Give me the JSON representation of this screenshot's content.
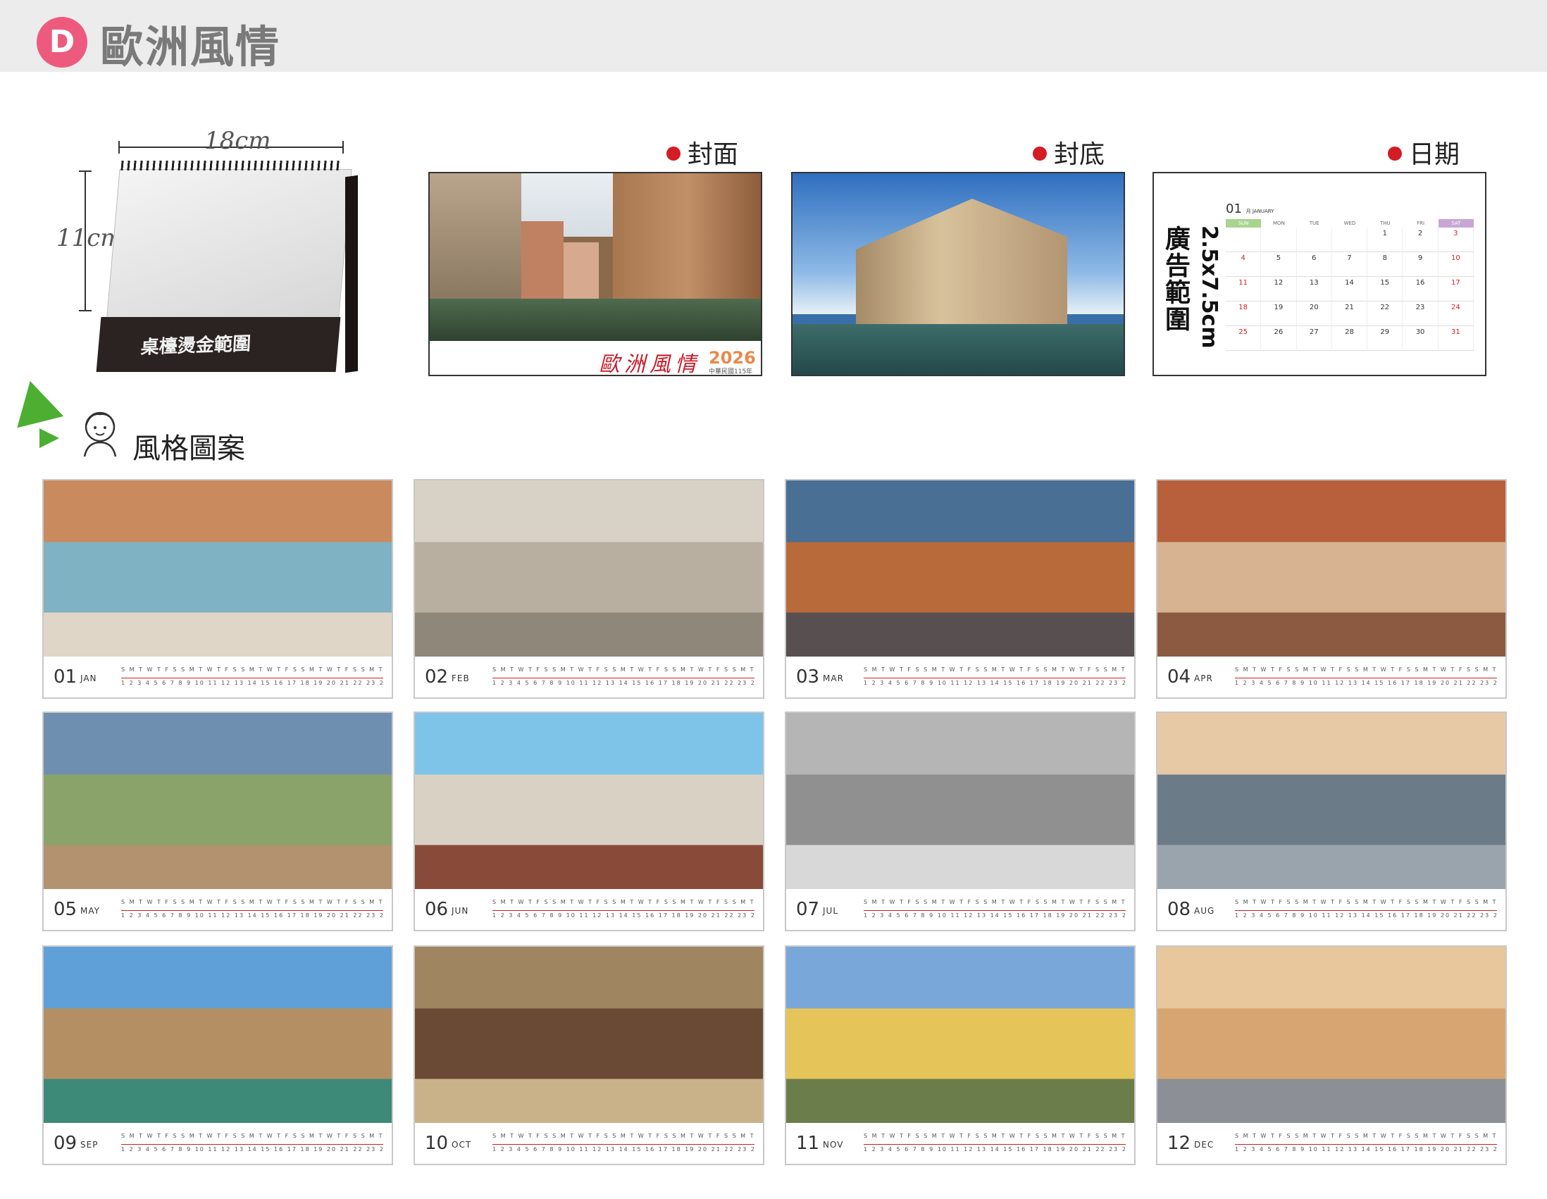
{
  "header": {
    "badge": "D",
    "title": "歐洲風情"
  },
  "product": {
    "width": "18cm",
    "height": "11cm",
    "foil_area": "桌檯燙金範圍"
  },
  "panels": [
    {
      "label": "封面"
    },
    {
      "label": "封底"
    },
    {
      "label": "日期"
    }
  ],
  "cover": {
    "title": "歐洲風情",
    "year": "2026",
    "roc": "中華民國115年"
  },
  "date_preview": {
    "ad_range": "廣告範圍",
    "ad_size": "2.5x7.5cm",
    "month_num": "01",
    "month_sup": "月 JANUARY",
    "weekdays": [
      "SUN",
      "MON",
      "TUE",
      "WED",
      "THU",
      "FRI",
      "SAT"
    ],
    "days": [
      "",
      "",
      "",
      "",
      "1",
      "2",
      "3",
      "4",
      "5",
      "6",
      "7",
      "8",
      "9",
      "10",
      "11",
      "12",
      "13",
      "14",
      "15",
      "16",
      "17",
      "18",
      "19",
      "20",
      "21",
      "22",
      "23",
      "24",
      "25",
      "26",
      "27",
      "28",
      "29",
      "30",
      "31"
    ]
  },
  "style": {
    "title": "風格圖案"
  },
  "months": [
    {
      "num": "01",
      "en": "JAN"
    },
    {
      "num": "02",
      "en": "FEB"
    },
    {
      "num": "03",
      "en": "MAR"
    },
    {
      "num": "04",
      "en": "APR"
    },
    {
      "num": "05",
      "en": "MAY"
    },
    {
      "num": "06",
      "en": "JUN"
    },
    {
      "num": "07",
      "en": "JUL"
    },
    {
      "num": "08",
      "en": "AUG"
    },
    {
      "num": "09",
      "en": "SEP"
    },
    {
      "num": "10",
      "en": "OCT"
    },
    {
      "num": "11",
      "en": "NOV"
    },
    {
      "num": "12",
      "en": "DEC"
    }
  ],
  "colors": {
    "badge": "#ee5a7e",
    "dot": "#d41c24",
    "cover_title": "#c81c2a",
    "year": "#e8894a",
    "green": "#4caf32"
  }
}
